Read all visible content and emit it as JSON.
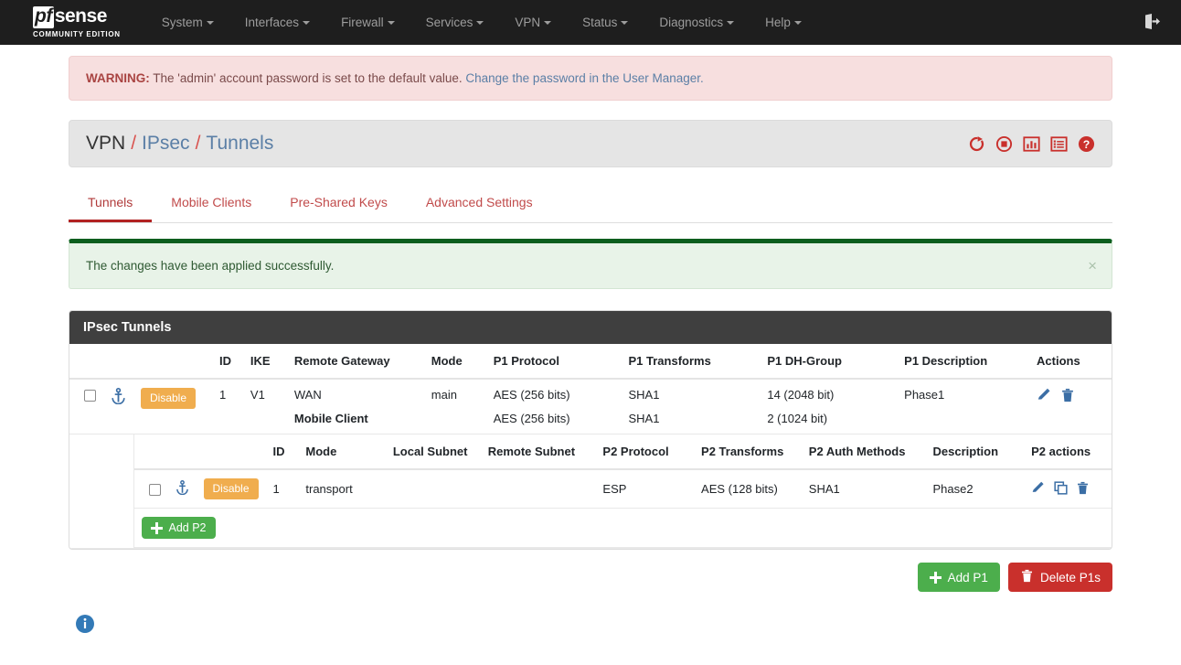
{
  "navbar": {
    "brand": {
      "pf": "pf",
      "sense": "sense",
      "subtitle": "COMMUNITY EDITION"
    },
    "items": [
      {
        "label": "System"
      },
      {
        "label": "Interfaces"
      },
      {
        "label": "Firewall"
      },
      {
        "label": "Services"
      },
      {
        "label": "VPN"
      },
      {
        "label": "Status"
      },
      {
        "label": "Diagnostics"
      },
      {
        "label": "Help"
      }
    ],
    "logout_icon": "logout-icon"
  },
  "warning": {
    "prefix": "WARNING:",
    "text": "The 'admin' account password is set to the default value.",
    "link": "Change the password in the User Manager."
  },
  "breadcrumb": {
    "root": "VPN",
    "sep": "/",
    "level2": "IPsec",
    "level3": "Tunnels",
    "icons": [
      {
        "name": "restart-service-icon"
      },
      {
        "name": "stop-service-icon"
      },
      {
        "name": "status-graph-icon"
      },
      {
        "name": "log-list-icon"
      },
      {
        "name": "help-icon"
      }
    ]
  },
  "tabs": [
    {
      "label": "Tunnels",
      "active": true
    },
    {
      "label": "Mobile Clients",
      "active": false
    },
    {
      "label": "Pre-Shared Keys",
      "active": false
    },
    {
      "label": "Advanced Settings",
      "active": false
    }
  ],
  "success_alert": {
    "message": "The changes have been applied successfully.",
    "close": "×"
  },
  "panel": {
    "title": "IPsec Tunnels",
    "p1_headers": [
      "",
      "",
      "",
      "ID",
      "IKE",
      "Remote Gateway",
      "Mode",
      "P1 Protocol",
      "P1 Transforms",
      "P1 DH-Group",
      "P1 Description",
      "Actions"
    ],
    "p1_rows": [
      {
        "disable_label": "Disable",
        "id": "1",
        "ike": "V1",
        "remote_gateway_line1": "WAN",
        "remote_gateway_line2": "Mobile Client",
        "mode": "main",
        "p1_protocol_line1": "AES (256 bits)",
        "p1_protocol_line2": "AES (256 bits)",
        "p1_transforms_line1": "SHA1",
        "p1_transforms_line2": "SHA1",
        "p1_dhgroup_line1": "14 (2048 bit)",
        "p1_dhgroup_line2": "2 (1024 bit)",
        "p1_description": "Phase1"
      }
    ],
    "p2_headers": [
      "",
      "",
      "",
      "ID",
      "Mode",
      "Local Subnet",
      "Remote Subnet",
      "P2 Protocol",
      "P2 Transforms",
      "P2 Auth Methods",
      "Description",
      "P2 actions"
    ],
    "p2_rows": [
      {
        "disable_label": "Disable",
        "id": "1",
        "mode": "transport",
        "local_subnet": "",
        "remote_subnet": "",
        "p2_protocol": "ESP",
        "p2_transforms": "AES (128 bits)",
        "p2_auth_methods": "SHA1",
        "description": "Phase2"
      }
    ],
    "add_p2_label": "Add P2"
  },
  "footer_buttons": {
    "add_p1": "Add P1",
    "delete_p1s": "Delete P1s"
  },
  "colors": {
    "navbar_bg": "#1e1e1e",
    "accent_red": "#b22222",
    "badge_orange": "#f0ad4e",
    "success_green": "#4cae4c",
    "danger_red": "#c9302c",
    "link_blue": "#5b7fa6",
    "icon_blue": "#3b6ea5"
  }
}
